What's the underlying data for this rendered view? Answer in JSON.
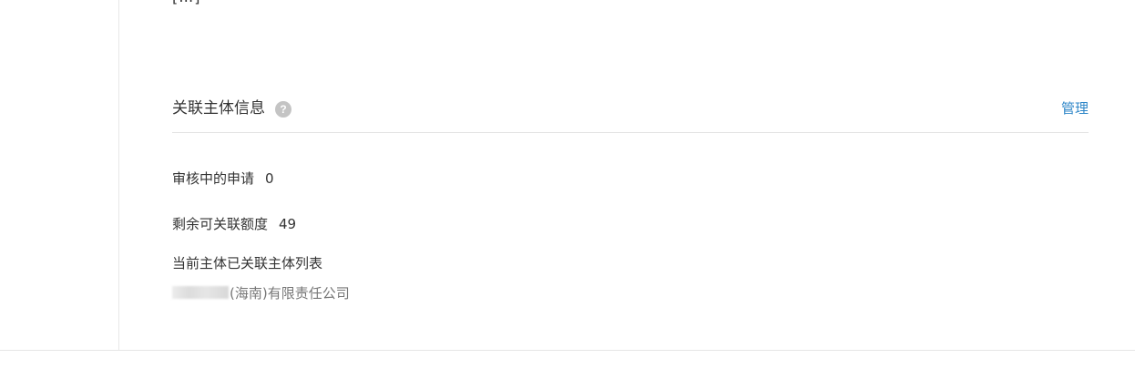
{
  "top_clipped_text": "[…]",
  "section": {
    "title": "关联主体信息",
    "help_icon": "question-circle-icon",
    "manage_label": "管理"
  },
  "pending": {
    "label": "审核中的申请",
    "value": "0"
  },
  "quota": {
    "label": "剩余可关联额度",
    "value": "49"
  },
  "linked_list": {
    "title": "当前主体已关联主体列表",
    "items": [
      {
        "name_suffix": "(海南)有限责任公司"
      }
    ]
  },
  "colors": {
    "link": "#2f87c8",
    "text": "#333333",
    "muted": "#777777",
    "help_icon_bg": "#c4c4c4"
  }
}
